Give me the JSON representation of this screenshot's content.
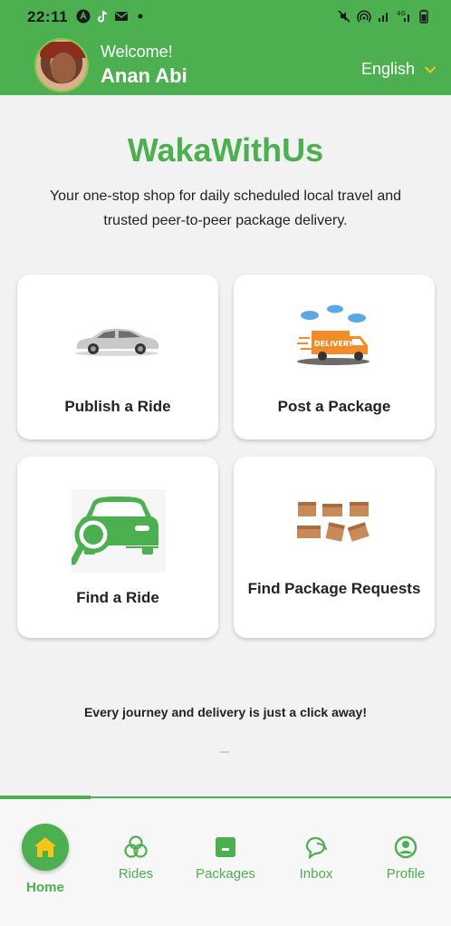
{
  "status_bar": {
    "time": "22:11",
    "left_icons": [
      "app-a-icon",
      "tiktok-icon",
      "mail-icon",
      "dot-icon"
    ],
    "right_icons": [
      "mute-icon",
      "hotspot-icon",
      "signal-icon",
      "4g-signal-icon",
      "battery-icon"
    ]
  },
  "header": {
    "welcome": "Welcome!",
    "user_name": "Anan Abi",
    "language": "English"
  },
  "main": {
    "brand": "WakaWithUs",
    "tagline": "Your one-stop shop for daily scheduled local travel and trusted peer-to-peer package delivery.",
    "cards": [
      {
        "label": "Publish a Ride",
        "icon": "car-image"
      },
      {
        "label": "Post a Package",
        "icon": "delivery-truck-image"
      },
      {
        "label": "Find a Ride",
        "icon": "car-search-icon"
      },
      {
        "label": "Find Package Requests",
        "icon": "boxes-image"
      }
    ],
    "footer_text": "Every journey and delivery is just a click away!"
  },
  "delivery_sign": "DELIVERY",
  "bottom_nav": {
    "items": [
      {
        "label": "Home",
        "icon": "home-icon",
        "active": true
      },
      {
        "label": "Rides",
        "icon": "rides-icon"
      },
      {
        "label": "Packages",
        "icon": "packages-icon"
      },
      {
        "label": "Inbox",
        "icon": "inbox-icon"
      },
      {
        "label": "Profile",
        "icon": "profile-icon"
      }
    ]
  },
  "colors": {
    "accent": "#4caf50",
    "header_bg": "#4caf50",
    "home_icon": "#f5c518",
    "chevron": "#f5c518"
  }
}
